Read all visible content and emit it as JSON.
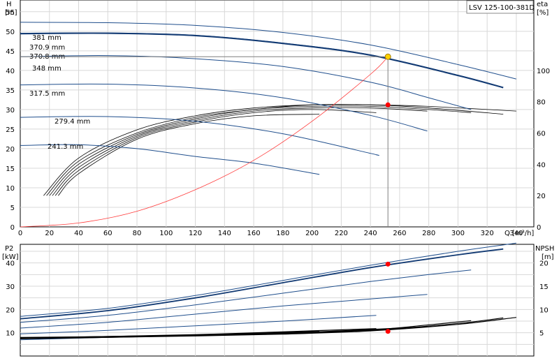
{
  "model": "LSV 125-100-381D",
  "colors": {
    "curve": "#1f4e8c",
    "curve_selected": "#123a73",
    "system_curve": "#ff3b3b",
    "efficiency": "#000000",
    "grid": "#d8d8d8",
    "duty_point": "#ff0000",
    "duty_point_head": "#ffd200",
    "marker_line": "#7f7f7f"
  },
  "top_panel": {
    "left_axis": {
      "label": "H",
      "unit": "[m]",
      "ticks": [
        "0",
        "5",
        "10",
        "15",
        "20",
        "25",
        "30",
        "35",
        "40",
        "45",
        "50",
        "55"
      ],
      "ylim": [
        0,
        58
      ]
    },
    "right_axis": {
      "label": "eta",
      "unit": "[%]",
      "ticks": [
        "0",
        "20",
        "40",
        "60",
        "80",
        "100"
      ],
      "ylim": [
        0,
        145
      ]
    },
    "x_axis": {
      "label": "Q [m³/h]",
      "ticks": [
        "0",
        "20",
        "40",
        "60",
        "80",
        "100",
        "120",
        "140",
        "160",
        "180",
        "200",
        "220",
        "240",
        "260",
        "280",
        "300",
        "320",
        "340"
      ],
      "xlim": [
        0,
        352
      ]
    },
    "grid": true
  },
  "bottom_panel": {
    "left_axis": {
      "label": "P2",
      "unit": "[kW]",
      "ticks": [
        "10",
        "20",
        "30",
        "40"
      ],
      "ylim": [
        0,
        48
      ]
    },
    "right_axis": {
      "label": "NPSH",
      "unit": "[m]",
      "ticks": [
        "5",
        "10",
        "15",
        "20"
      ],
      "ylim": [
        0,
        24
      ]
    },
    "grid": true
  },
  "duty_point": {
    "Q": 252,
    "H": 43.5,
    "eta": 78,
    "P2": 39.5,
    "NPSH": 5.3
  },
  "chart_data": [
    {
      "type": "line",
      "panel": "top",
      "title": "",
      "xlabel": "Q [m³/h]",
      "ylabel": "H [m]",
      "xlim": [
        0,
        352
      ],
      "ylim": [
        0,
        58
      ],
      "series": [
        {
          "name": "381 mm",
          "x": [
            0,
            60,
            120,
            180,
            240,
            300,
            340
          ],
          "y": [
            52.3,
            52.2,
            51.5,
            49.7,
            46.5,
            41.5,
            37.8
          ]
        },
        {
          "name": "370.9 mm",
          "x": [
            0,
            60,
            120,
            180,
            240,
            300,
            331
          ],
          "y": [
            49.5,
            49.6,
            49.0,
            47.0,
            44.0,
            38.8,
            35.7
          ]
        },
        {
          "name": "370.8 mm",
          "x": [
            0,
            60,
            120,
            180,
            240,
            300,
            331
          ],
          "y": [
            49.4,
            49.5,
            48.9,
            46.9,
            43.9,
            38.7,
            35.6
          ]
        },
        {
          "name": "348 mm",
          "x": [
            0,
            60,
            120,
            180,
            240,
            280,
            309
          ],
          "y": [
            43.5,
            43.8,
            43.0,
            41.0,
            37.0,
            33.0,
            30.0
          ]
        },
        {
          "name": "317.5 mm",
          "x": [
            0,
            60,
            120,
            180,
            240,
            279
          ],
          "y": [
            36.3,
            36.5,
            35.5,
            33.0,
            28.5,
            24.5
          ]
        },
        {
          "name": "279.4 mm",
          "x": [
            0,
            60,
            120,
            180,
            240,
            244
          ],
          "y": [
            28.0,
            28.2,
            27.0,
            23.8,
            18.8,
            18.4
          ]
        },
        {
          "name": "241.3 mm",
          "x": [
            0,
            40,
            80,
            120,
            160,
            205
          ],
          "y": [
            20.8,
            21.0,
            20.0,
            18.0,
            16.3,
            13.4
          ]
        },
        {
          "name": "system curve",
          "x": [
            0,
            40,
            80,
            120,
            160,
            200,
            240,
            252
          ],
          "y": [
            0,
            1.0,
            4.0,
            9.5,
            17.0,
            27.0,
            39.0,
            43.5
          ]
        }
      ]
    },
    {
      "type": "line",
      "panel": "top",
      "title": "",
      "xlabel": "Q [m³/h]",
      "ylabel": "eta [%]",
      "xlim": [
        0,
        352
      ],
      "ylim": [
        0,
        145
      ],
      "series": [
        {
          "x": [
            16,
            40,
            80,
            120,
            160,
            200,
            240,
            280,
            340
          ],
          "y": [
            20,
            44,
            62,
            71,
            76,
            78,
            78,
            77,
            74
          ]
        },
        {
          "x": [
            18,
            40,
            80,
            120,
            160,
            200,
            240,
            280,
            331
          ],
          "y": [
            20,
            42,
            60,
            70,
            75,
            78,
            78,
            76,
            72
          ]
        },
        {
          "x": [
            20,
            40,
            80,
            120,
            160,
            200,
            240,
            280,
            309
          ],
          "y": [
            20,
            40,
            59,
            69,
            75,
            77,
            77,
            75,
            73
          ]
        },
        {
          "x": [
            22,
            40,
            80,
            120,
            160,
            200,
            240,
            279
          ],
          "y": [
            20,
            38,
            58,
            68,
            74,
            76,
            76,
            74
          ]
        },
        {
          "x": [
            24,
            40,
            80,
            120,
            160,
            200,
            244
          ],
          "y": [
            20,
            36,
            57,
            67,
            73,
            75,
            73
          ]
        },
        {
          "x": [
            26,
            40,
            80,
            120,
            160,
            205
          ],
          "y": [
            20,
            34,
            56,
            66,
            71,
            72
          ]
        }
      ]
    },
    {
      "type": "line",
      "panel": "bottom",
      "title": "",
      "xlabel": "Q [m³/h]",
      "ylabel": "P2 [kW]",
      "xlim": [
        0,
        352
      ],
      "ylim": [
        0,
        48
      ],
      "series": [
        {
          "name": "381 mm",
          "x": [
            0,
            60,
            120,
            180,
            240,
            300,
            340
          ],
          "y": [
            17.0,
            20.5,
            26.0,
            32.5,
            39.0,
            45.0,
            48.5
          ]
        },
        {
          "name": "370.9 mm",
          "x": [
            0,
            60,
            120,
            180,
            240,
            300,
            331
          ],
          "y": [
            16.0,
            19.5,
            25.0,
            31.5,
            38.0,
            43.5,
            46.0
          ]
        },
        {
          "name": "348 mm",
          "x": [
            0,
            60,
            120,
            180,
            240,
            280,
            309
          ],
          "y": [
            14.5,
            17.5,
            22.0,
            27.0,
            32.0,
            35.0,
            37.0
          ]
        },
        {
          "name": "317.5 mm",
          "x": [
            0,
            60,
            120,
            180,
            240,
            279
          ],
          "y": [
            12.0,
            14.5,
            18.0,
            21.5,
            24.5,
            26.5
          ]
        },
        {
          "name": "279.4 mm",
          "x": [
            0,
            60,
            120,
            180,
            244
          ],
          "y": [
            9.5,
            11.0,
            13.0,
            15.0,
            17.5
          ]
        },
        {
          "name": "241.3 mm",
          "x": [
            0,
            60,
            120,
            160,
            205
          ],
          "y": [
            7.0,
            8.0,
            9.0,
            9.5,
            10.0
          ]
        }
      ]
    },
    {
      "type": "line",
      "panel": "bottom",
      "title": "",
      "xlabel": "Q [m³/h]",
      "ylabel": "NPSH [m]",
      "xlim": [
        0,
        352
      ],
      "ylim": [
        0,
        24
      ],
      "series": [
        {
          "x": [
            0,
            60,
            120,
            180,
            240,
            300,
            340
          ],
          "y": [
            3.8,
            4.0,
            4.3,
            4.7,
            5.4,
            6.8,
            8.3
          ]
        },
        {
          "x": [
            0,
            60,
            120,
            180,
            240,
            300,
            331
          ],
          "y": [
            3.9,
            4.1,
            4.4,
            4.8,
            5.5,
            7.0,
            8.2
          ]
        },
        {
          "x": [
            0,
            60,
            120,
            180,
            240,
            280,
            309
          ],
          "y": [
            4.0,
            4.2,
            4.5,
            4.9,
            5.6,
            6.7,
            7.6
          ]
        },
        {
          "x": [
            0,
            60,
            120,
            180,
            240,
            279
          ],
          "y": [
            3.7,
            4.0,
            4.4,
            4.9,
            5.7,
            6.3
          ]
        },
        {
          "x": [
            0,
            60,
            120,
            180,
            244
          ],
          "y": [
            3.9,
            4.2,
            4.6,
            5.2,
            5.9
          ]
        },
        {
          "x": [
            0,
            60,
            120,
            160,
            205
          ],
          "y": [
            3.8,
            4.1,
            4.5,
            4.9,
            5.3
          ]
        }
      ]
    }
  ]
}
